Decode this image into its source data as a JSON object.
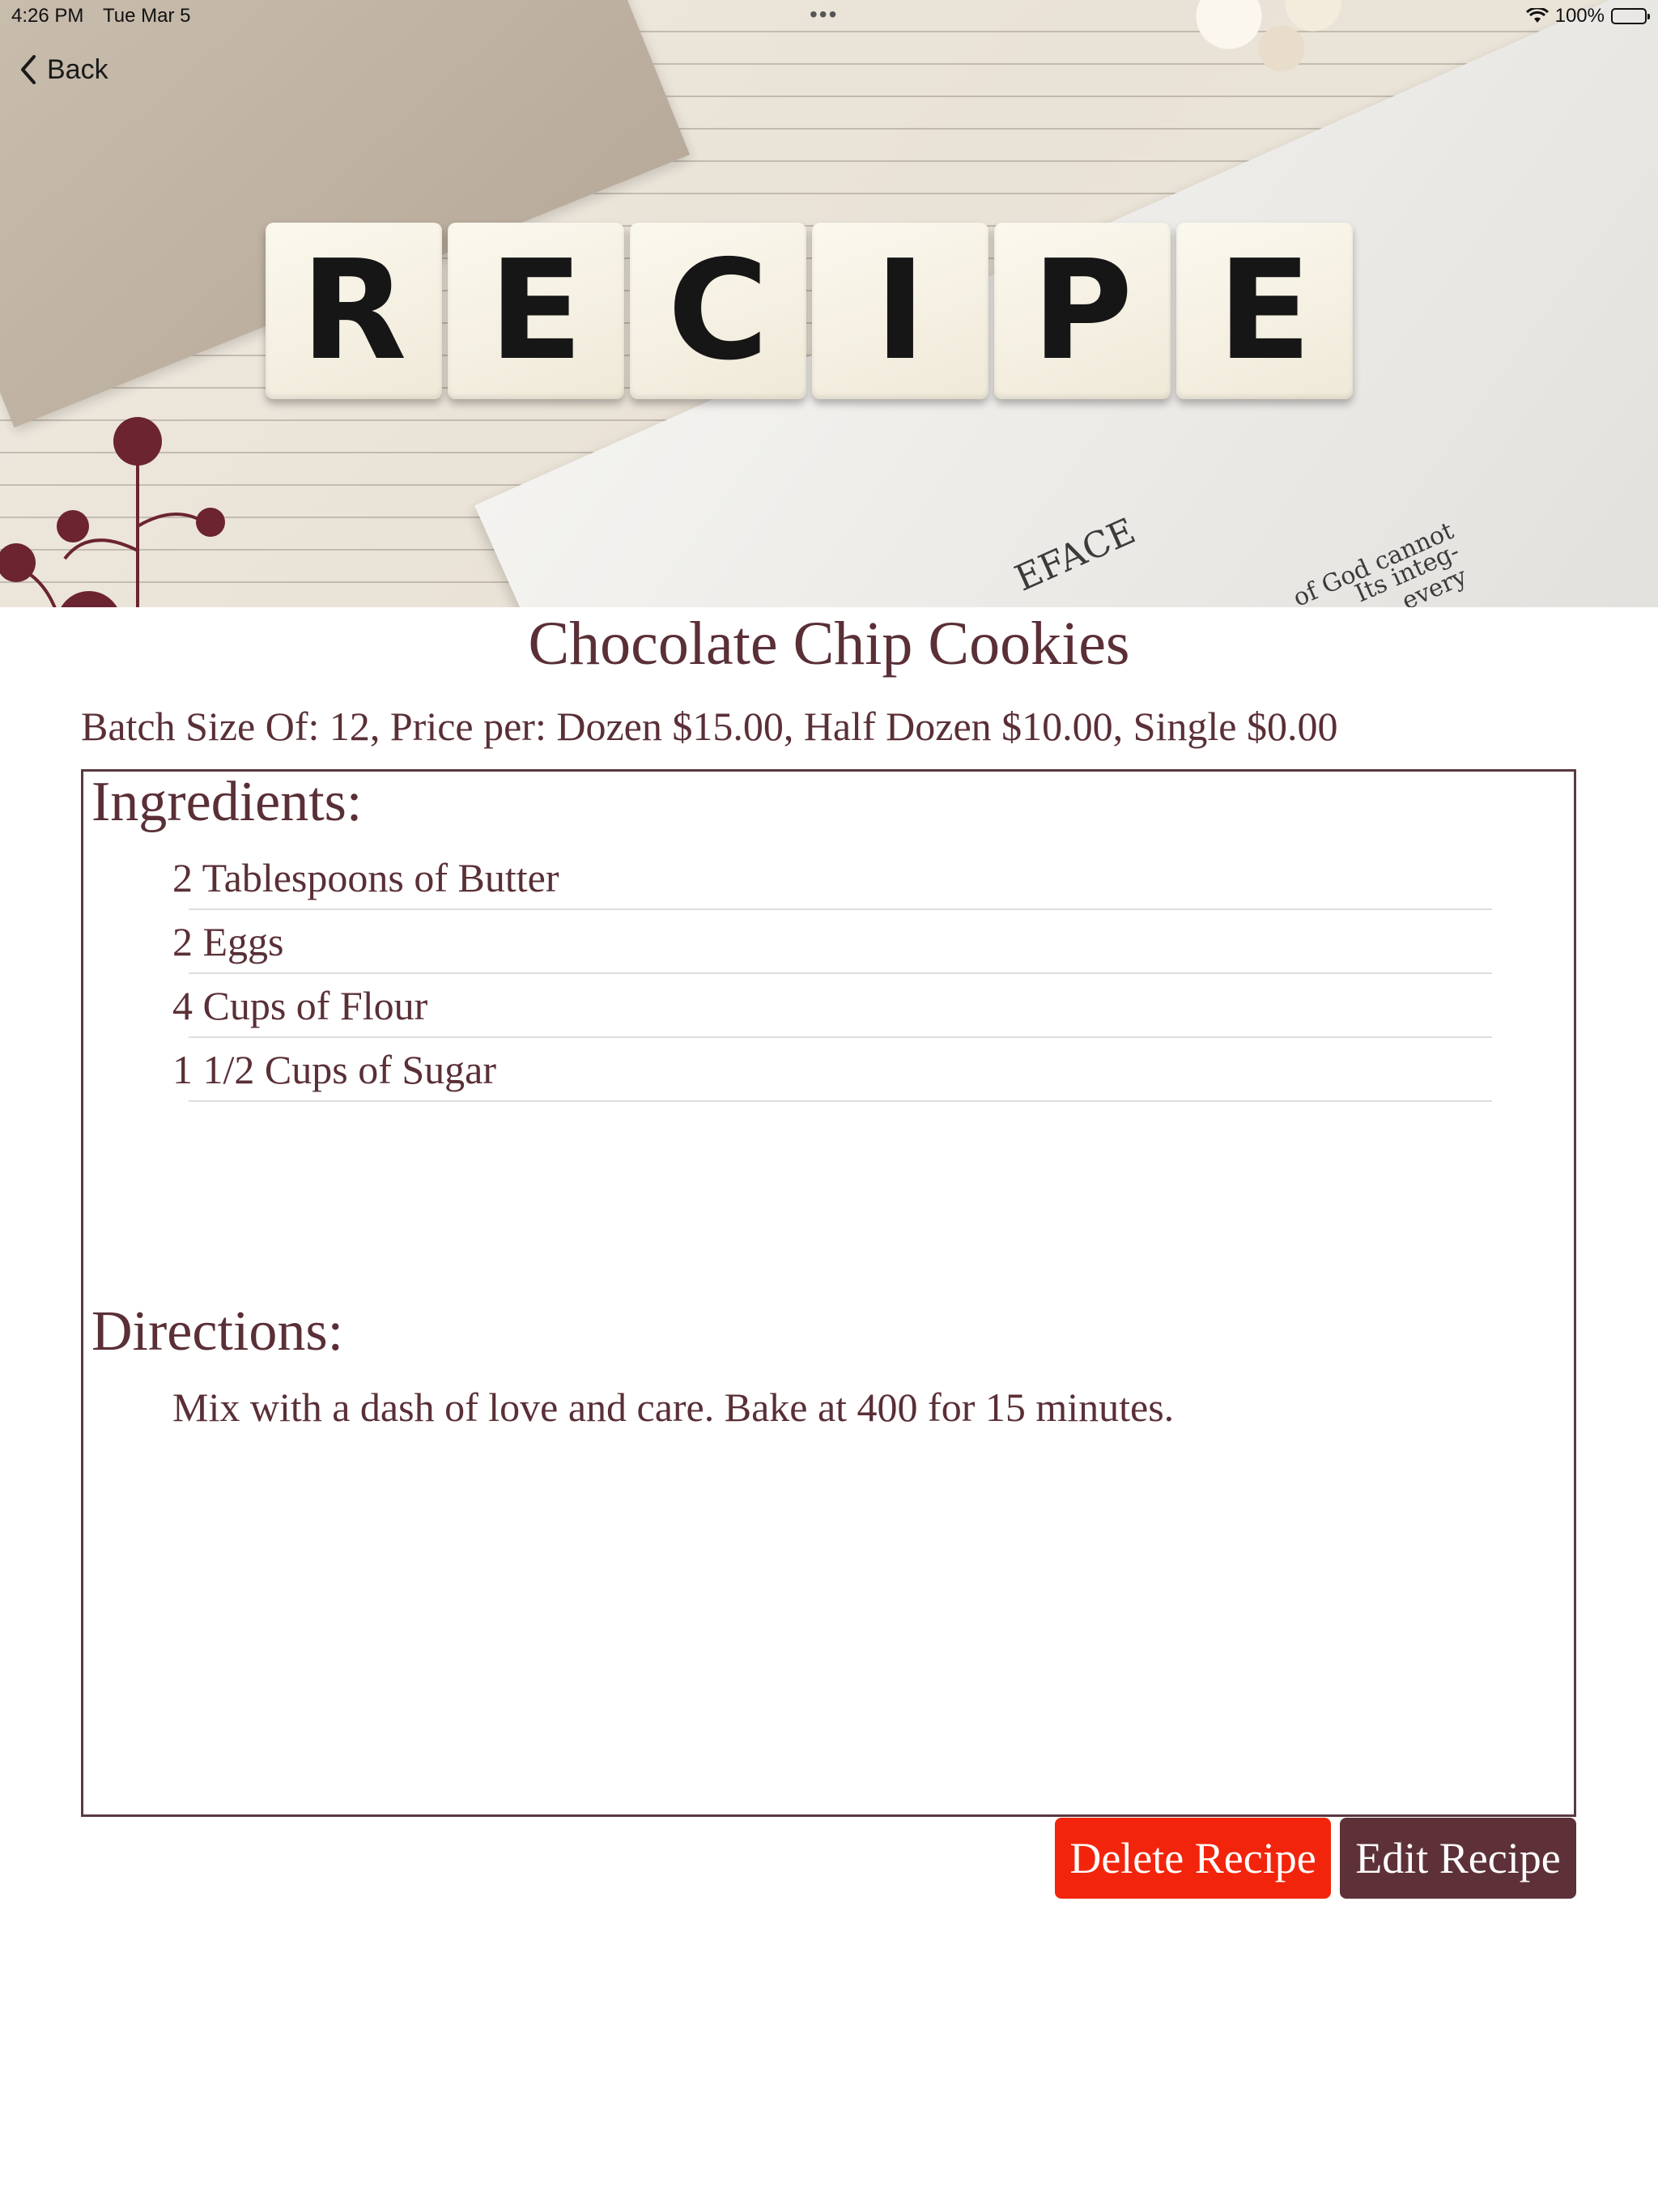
{
  "status_bar": {
    "time": "4:26 PM",
    "date": "Tue Mar 5",
    "battery": "100%",
    "multitask_dots": "•••",
    "icons": [
      "wifi-icon",
      "battery-icon"
    ]
  },
  "nav": {
    "back_label": "Back",
    "back_icon": "chevron-left-icon"
  },
  "header_image": {
    "tiles": [
      "R",
      "E",
      "C",
      "I",
      "P",
      "E"
    ],
    "paper_text": [
      "EFACE",
      "of God cannot",
      "Its integ-",
      "every"
    ]
  },
  "recipe": {
    "title": "Chocolate Chip Cookies",
    "batch_info": "Batch Size Of: 12, Price per: Dozen $15.00, Half Dozen $10.00, Single $0.00",
    "ingredients_heading": "Ingredients:",
    "ingredients": [
      "2 Tablespoons of Butter",
      "2 Eggs",
      "4 Cups of Flour",
      "1 1/2 Cups of Sugar"
    ],
    "directions_heading": "Directions:",
    "directions": "Mix with a dash of love and care. Bake at 400 for 15 minutes."
  },
  "actions": {
    "delete_label": "Delete Recipe",
    "edit_label": "Edit Recipe"
  },
  "colors": {
    "text": "#5a2f36",
    "border": "#5a3a40",
    "delete": "#f2250c",
    "edit": "#5e3138"
  }
}
